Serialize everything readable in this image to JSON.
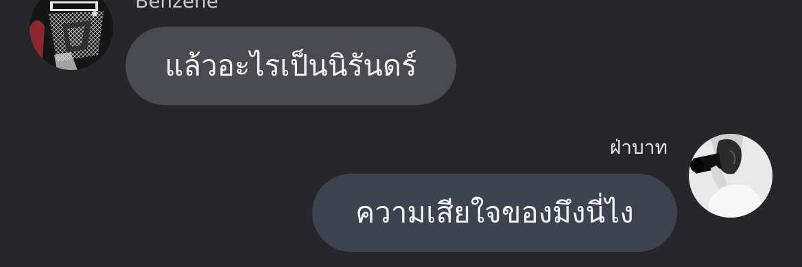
{
  "conversation": {
    "incoming": {
      "sender": "Benzene",
      "text": "แล้วอะไรเป็นนิรันดร์",
      "avatar_icon": "profile-avatar-dark"
    },
    "outgoing": {
      "sender": "ฝ่าบาท",
      "text": "ความเสียใจของมึงนี่ไง",
      "avatar_icon": "profile-avatar-light"
    }
  },
  "colors": {
    "background": "#26262b",
    "incoming_bubble": "#4a4b50",
    "outgoing_bubble": "#3e4350",
    "text": "#f2f2f4"
  }
}
